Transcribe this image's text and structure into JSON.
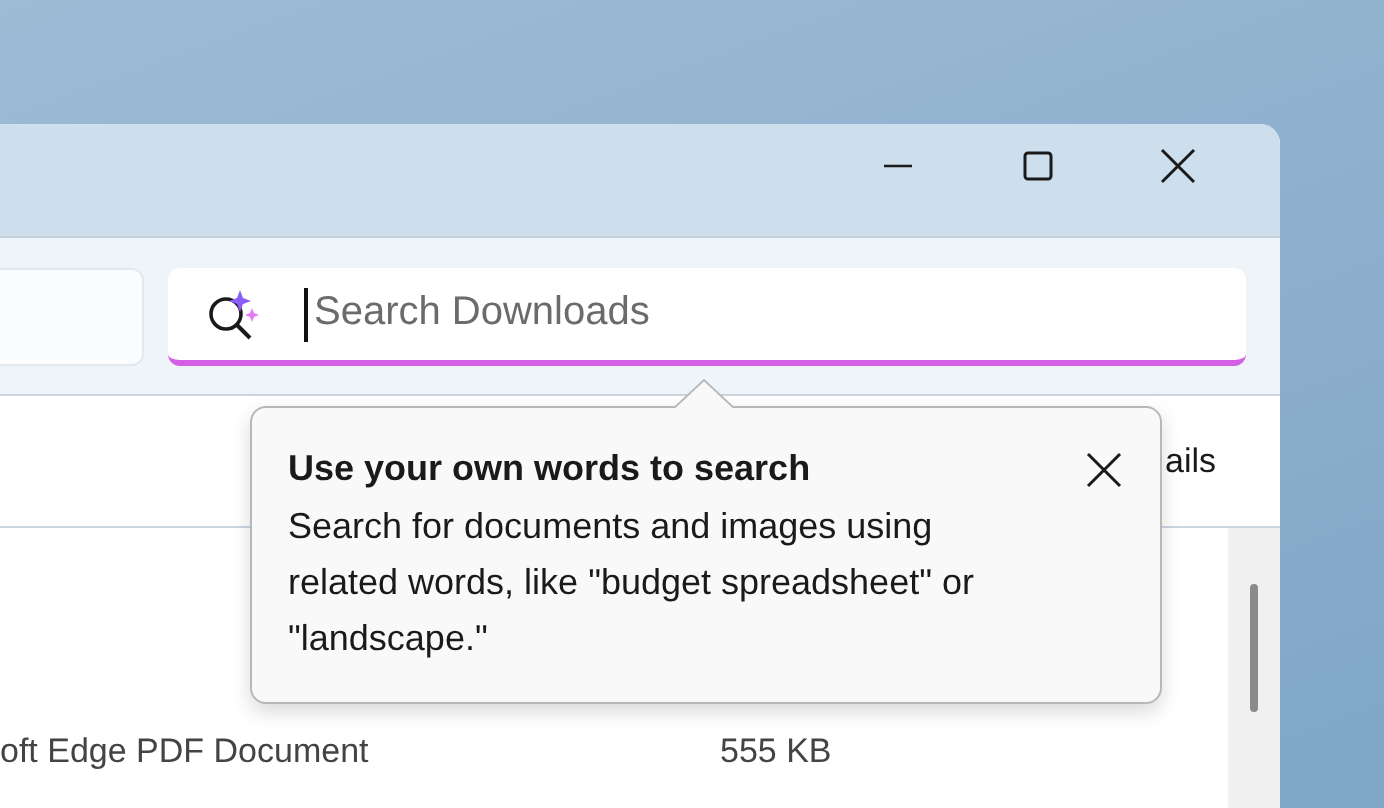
{
  "search": {
    "placeholder": "Search Downloads",
    "focused": true
  },
  "command_bar": {
    "cut_label": "ails"
  },
  "rows": [
    {
      "cells": [
        "oft Edge PDF Document",
        "555 KB"
      ]
    }
  ],
  "teaching_tip": {
    "title": "Use your own words to search",
    "body": "Search for documents and images using related words, like \"budget spreadsheet\" or \"landscape.\""
  }
}
